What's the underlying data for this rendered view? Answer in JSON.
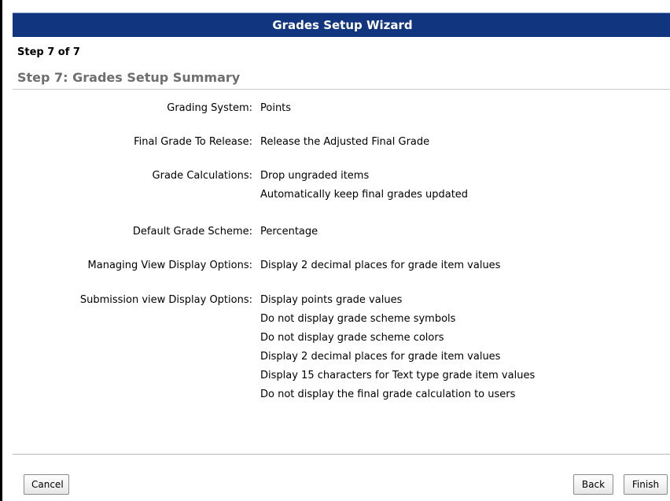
{
  "window": {
    "title": "Grades Setup Wizard"
  },
  "step": {
    "count": "Step 7 of 7",
    "title": "Step 7: Grades Setup Summary"
  },
  "summary": {
    "rows": [
      {
        "label": "Grading System:",
        "values": [
          "Points"
        ]
      },
      {
        "label": "Final Grade To Release:",
        "values": [
          "Release the Adjusted Final Grade"
        ]
      },
      {
        "label": "Grade Calculations:",
        "values": [
          "Drop ungraded items",
          "Automatically keep final grades updated"
        ]
      },
      {
        "label": "Default Grade Scheme:",
        "values": [
          "Percentage"
        ]
      },
      {
        "label": "Managing View Display Options:",
        "values": [
          "Display 2 decimal places for grade item values"
        ]
      },
      {
        "label": "Submission view Display Options:",
        "values": [
          "Display points grade values",
          "Do not display grade scheme symbols",
          "Do not display grade scheme colors",
          "Display 2 decimal places for grade item values",
          "Display 15 characters for Text type grade item values",
          "Do not display the final grade calculation to users"
        ]
      }
    ]
  },
  "buttons": {
    "cancel": "Cancel",
    "back": "Back",
    "finish": "Finish"
  },
  "colors": {
    "title_bar": "#11357f",
    "step_title": "#6e6e6e"
  }
}
